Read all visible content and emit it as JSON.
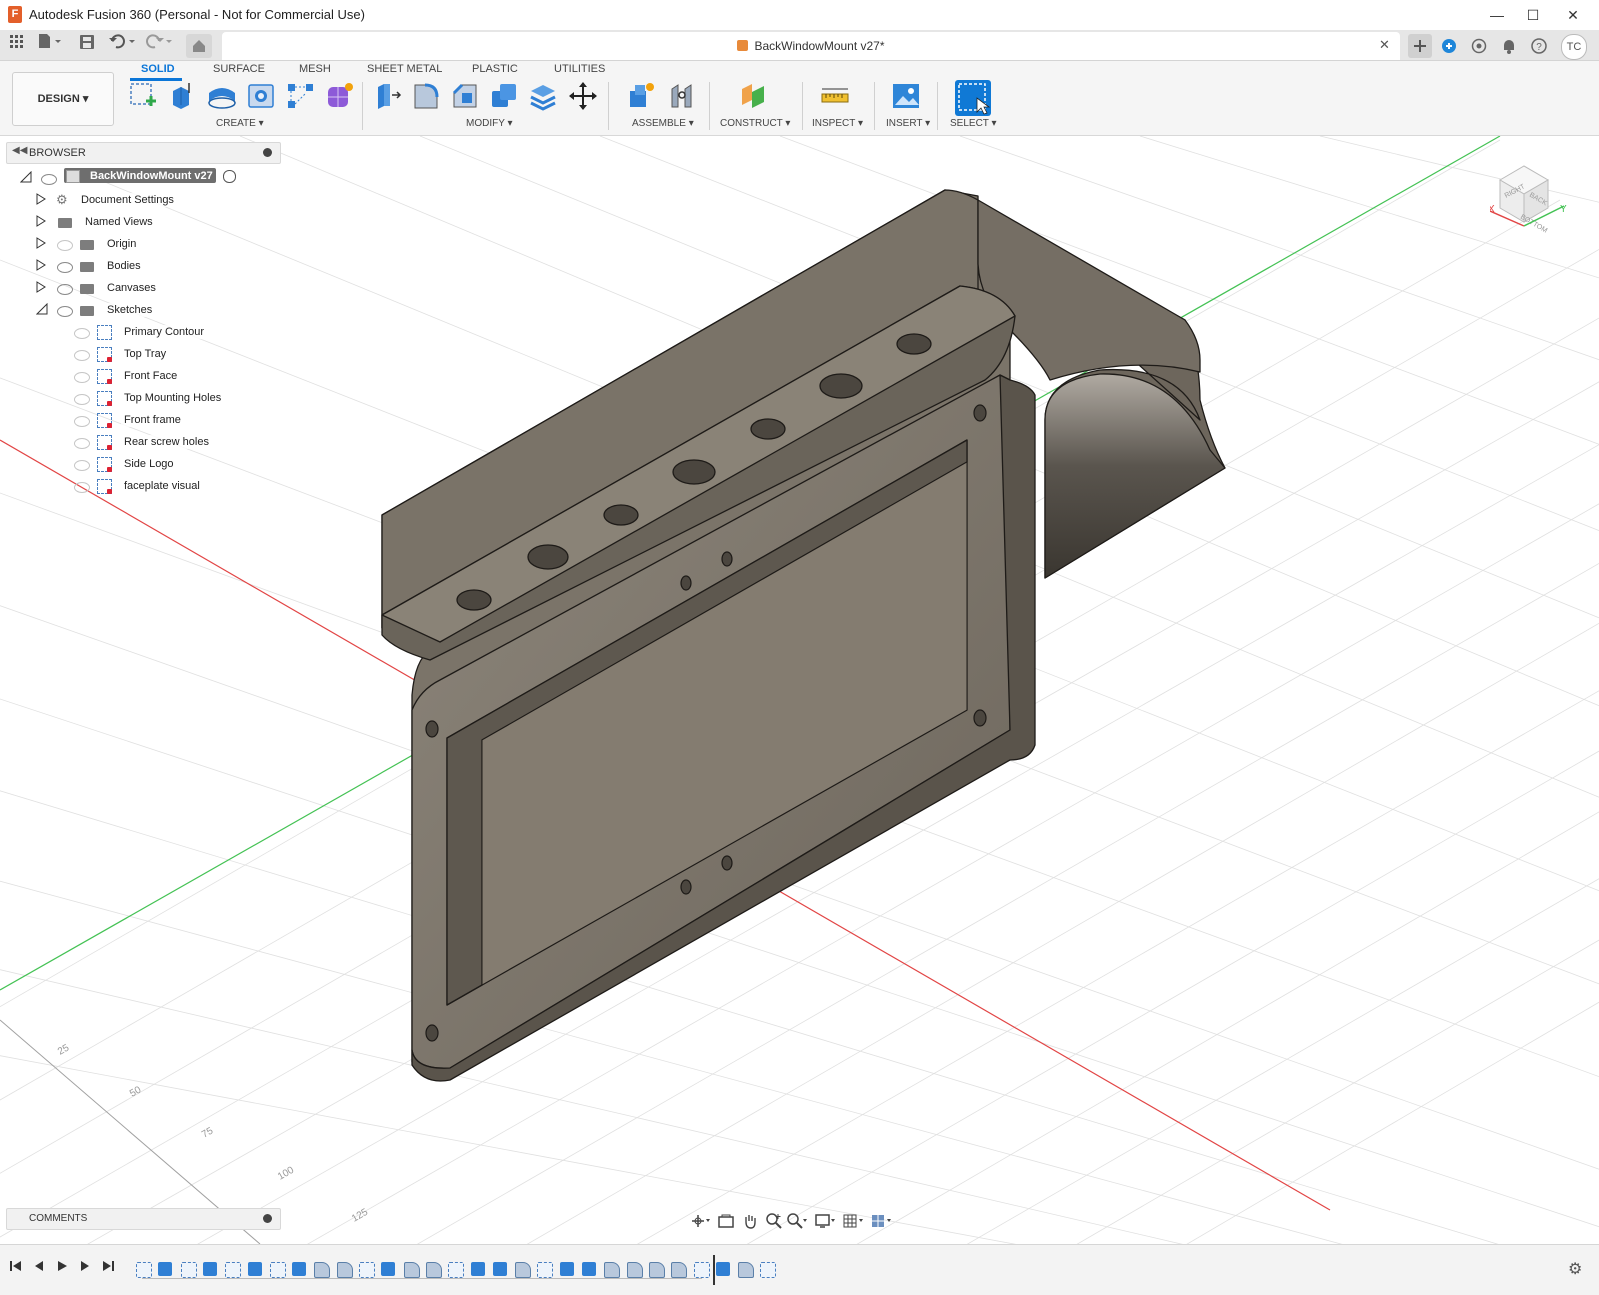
{
  "window": {
    "title": "Autodesk Fusion 360 (Personal - Not for Commercial Use)",
    "logo_letter": "F",
    "minimize": "—",
    "maximize": "☐",
    "close": "✕"
  },
  "document_tab": {
    "title": "BackWindowMount v27*",
    "close": "✕"
  },
  "user": {
    "initials": "TC"
  },
  "workspace": {
    "label": "DESIGN ▾"
  },
  "ribbon": {
    "tabs": [
      "SOLID",
      "SURFACE",
      "MESH",
      "SHEET METAL",
      "PLASTIC",
      "UTILITIES"
    ],
    "active_tab": "SOLID",
    "groups": [
      "CREATE ▾",
      "MODIFY ▾",
      "ASSEMBLE ▾",
      "CONSTRUCT ▾",
      "INSPECT ▾",
      "INSERT ▾",
      "SELECT ▾"
    ]
  },
  "browser": {
    "title": "BROWSER",
    "root": "BackWindowMount v27",
    "folders": [
      "Document Settings",
      "Named Views",
      "Origin",
      "Bodies",
      "Canvases",
      "Sketches"
    ],
    "sketches": [
      "Primary Contour",
      "Top Tray",
      "Front Face",
      "Top Mounting Holes",
      "Front frame",
      "Rear screw holes",
      "Side Logo",
      "faceplate visual"
    ]
  },
  "comments": {
    "label": "COMMENTS"
  },
  "viewcube": {
    "faces": [
      "RIGHT",
      "BACK",
      "BOTTOM"
    ],
    "axes": [
      "X",
      "Y"
    ]
  },
  "grid_labels": [
    "25",
    "50",
    "75",
    "100",
    "125"
  ],
  "colors": {
    "accent": "#0b76d8",
    "model_body": "#7d7469",
    "model_top": "#8a8276",
    "model_recess": "#857d71",
    "x_axis": "#e23b3b",
    "y_axis": "#3cc24b",
    "grid": "#d9d9d9"
  }
}
